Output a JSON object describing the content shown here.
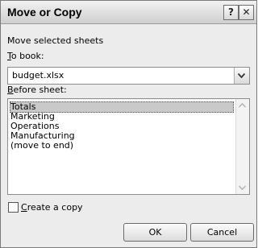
{
  "dialog": {
    "title": "Move or Copy",
    "help_glyph": "?",
    "close_glyph": "✕",
    "move_label": "Move selected sheets",
    "to_book": {
      "mnemonic": "T",
      "rest": "o book:",
      "value": "budget.xlsx"
    },
    "before_sheet": {
      "mnemonic": "B",
      "rest": "efore sheet:"
    },
    "sheets": [
      "Totals",
      "Marketing",
      "Operations",
      "Manufacturing",
      "(move to end)"
    ],
    "selected_sheet": "Totals",
    "create_copy": {
      "mnemonic": "C",
      "rest": "reate a copy",
      "checked": false
    },
    "ok_label": "OK",
    "cancel_label": "Cancel"
  }
}
